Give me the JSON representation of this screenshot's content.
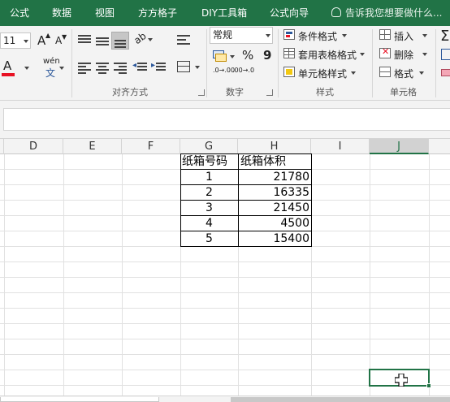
{
  "menu_tabs": [
    "公式",
    "数据",
    "视图",
    "方方格子",
    "DIY工具箱",
    "公式向导"
  ],
  "tell_me": "告诉我您想要做什么...",
  "ribbon": {
    "font": {
      "size": "11",
      "grow_label": "A",
      "shrink_label": "A",
      "font_color_label": "A",
      "phonetic_top": "wén",
      "phonetic_bottom": "文"
    },
    "alignment": {
      "label": "对齐方式"
    },
    "number": {
      "label": "数字",
      "format": "常规",
      "percent": "%",
      "comma": "9",
      "inc_decimal": ".0→.00",
      "dec_decimal": ".00→.0"
    },
    "styles": {
      "label": "样式",
      "conditional": "条件格式",
      "table_format": "套用表格格式",
      "cell_styles": "单元格样式"
    },
    "cells": {
      "label": "单元格",
      "insert": "插入",
      "delete": "删除",
      "format": "格式"
    }
  },
  "columns": [
    "D",
    "E",
    "F",
    "G",
    "H",
    "I",
    "J"
  ],
  "selected_column": "J",
  "table": {
    "headers": [
      "纸箱号码",
      "纸箱体积"
    ],
    "rows": [
      [
        "1",
        "21780"
      ],
      [
        "2",
        "16335"
      ],
      [
        "3",
        "21450"
      ],
      [
        "4",
        "4500"
      ],
      [
        "5",
        "15400"
      ]
    ]
  },
  "colors": {
    "accent": "#217346",
    "font_color_bar": "#e81123"
  }
}
